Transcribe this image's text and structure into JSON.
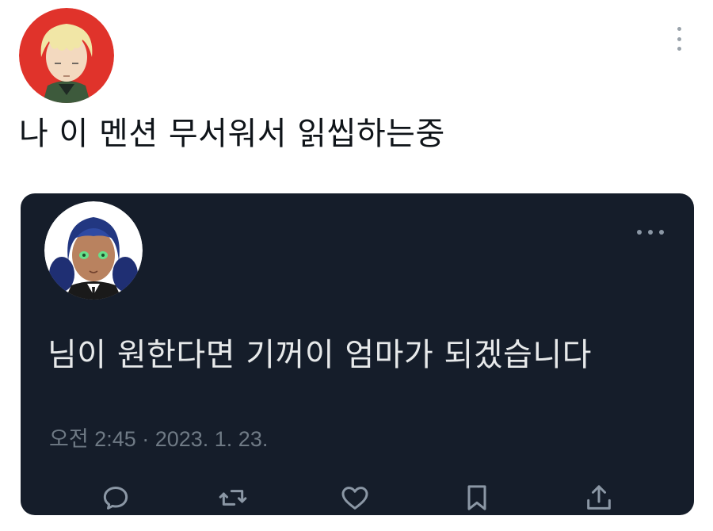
{
  "outer_tweet": {
    "text": "나 이 멘션 무서워서 읽씹하는중",
    "avatar_icon": "blonde-anime-character-avatar",
    "more_icon": "more-vertical-icon"
  },
  "quoted_tweet": {
    "text": "님이 원한다면 기꺼이 엄마가 되겠습니다",
    "avatar_icon": "navy-haired-anime-character-avatar",
    "more_icon": "more-horizontal-icon",
    "timestamp": "오전 2:45 · 2023. 1. 23."
  },
  "actions": [
    {
      "name": "reply",
      "icon": "reply-icon"
    },
    {
      "name": "retweet",
      "icon": "retweet-icon"
    },
    {
      "name": "like",
      "icon": "heart-icon"
    },
    {
      "name": "bookmark",
      "icon": "bookmark-icon"
    },
    {
      "name": "share",
      "icon": "share-icon"
    }
  ],
  "colors": {
    "card_background": "#151d2a",
    "card_text": "#e7e9ea",
    "meta_text": "#6f7a85",
    "icon": "#8b97a5",
    "avatar_ring": "#e0332b"
  }
}
